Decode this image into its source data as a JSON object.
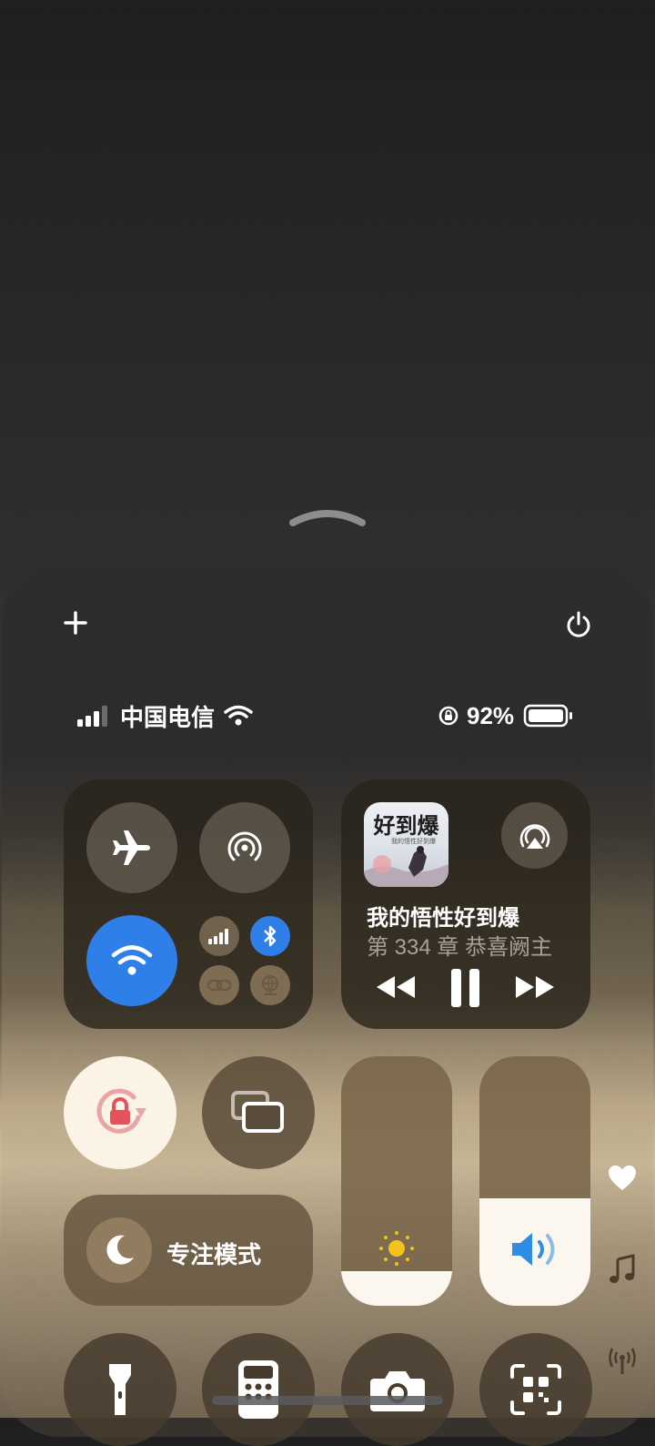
{
  "status_bar": {
    "carrier": "中国电信",
    "battery_percent": "92%"
  },
  "media": {
    "cover_title": "好到爆",
    "cover_subtitle": "我的悟性好到爆",
    "title": "我的悟性好到爆",
    "subtitle": "第 334 章 恭喜阙主"
  },
  "focus": {
    "label": "专注模式"
  },
  "sliders": {
    "brightness_level": 0.14,
    "volume_level": 0.43
  },
  "colors": {
    "accent_blue": "#2f7fe8",
    "lock_red": "#e4535b",
    "sun_yellow": "#f5c21b",
    "speaker_blue": "#2f8de4"
  },
  "icons": {
    "add": "plus-icon",
    "power": "power-icon",
    "airplane": "airplane-icon",
    "hotspot": "airdrop-icon",
    "wifi": "wifi-icon",
    "cellular": "cellular-icon",
    "bluetooth": "bluetooth-icon",
    "link": "link-icon",
    "vpn": "vpn-icon",
    "airplay": "airplay-icon",
    "rotation_lock": "rotation-lock-icon",
    "screen_mirror": "screen-mirror-icon",
    "moon": "moon-icon",
    "sun": "sun-icon",
    "speaker": "speaker-icon",
    "heart": "heart-icon",
    "music": "music-icon",
    "signal": "signal-tower-icon",
    "flashlight": "flashlight-icon",
    "calculator": "calculator-icon",
    "camera": "camera-icon",
    "qr": "qr-code-icon"
  }
}
